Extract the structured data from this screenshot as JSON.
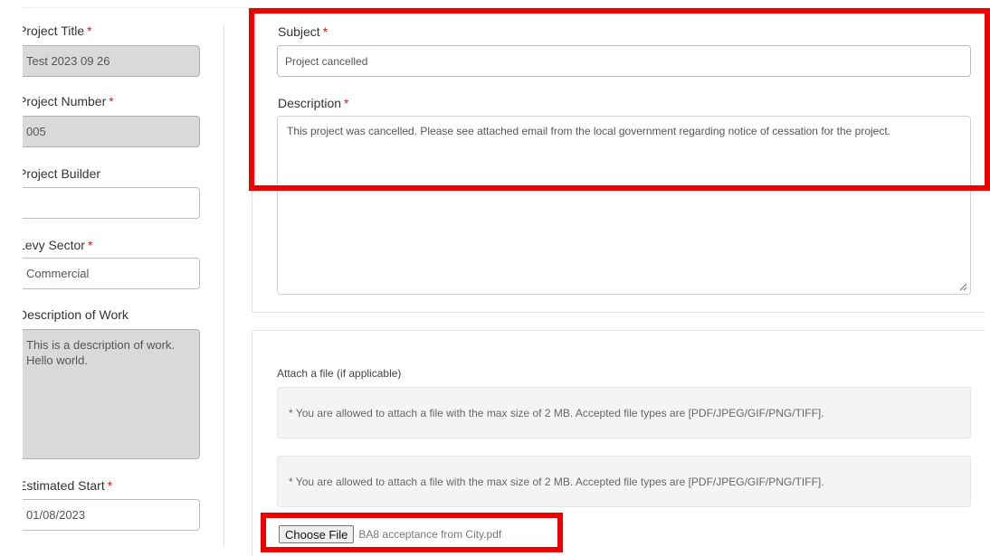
{
  "left_panel": {
    "project_title": {
      "label": "Project Title",
      "value": "Test 2023 09 26"
    },
    "project_number": {
      "label": "Project Number",
      "value": "005"
    },
    "project_builder": {
      "label": "Project Builder",
      "value": ""
    },
    "levy_sector": {
      "label": "Levy Sector",
      "value": "Commercial"
    },
    "description_of_work": {
      "label": "Description of Work",
      "value_line1": "This is a description of work.",
      "value_line2": "Hello world."
    },
    "estimated_start": {
      "label": "Estimated Start",
      "value": "01/08/2023"
    },
    "required_marker": "*"
  },
  "main": {
    "subject": {
      "label": "Subject",
      "value": "Project cancelled"
    },
    "description": {
      "label": "Description",
      "value": "This project was cancelled. Please see attached email from the local government regarding notice of cessation for the project."
    },
    "attach": {
      "label": "Attach a file (if applicable)",
      "note_1": "* You are allowed to attach a file with the max size of 2 MB. Accepted file types are [PDF/JPEG/GIF/PNG/TIFF].",
      "note_2": "* You are allowed to attach a file with the max size of 2 MB. Accepted file types are [PDF/JPEG/GIF/PNG/TIFF].",
      "choose_file_label": "Choose File",
      "file_name": "BA8 acceptance from City.pdf"
    },
    "required_marker": "*"
  },
  "colors": {
    "highlight": "#ee0000",
    "required": "#d21a1a",
    "readonly_bg": "#d9d9d9"
  }
}
